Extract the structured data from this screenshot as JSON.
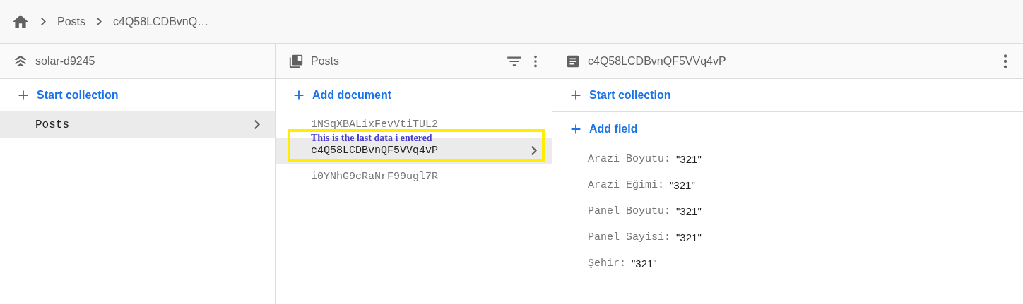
{
  "breadcrumb": [
    {
      "kind": "home"
    },
    {
      "kind": "text",
      "label": "Posts"
    },
    {
      "kind": "text",
      "label": "c4Q58LCDBvnQ…"
    }
  ],
  "columns": [
    {
      "kind": "project",
      "title": "solar-d9245",
      "actions": [
        "Start collection"
      ],
      "items": [
        {
          "label": "Posts",
          "selected": true
        }
      ]
    },
    {
      "kind": "collection",
      "title": "Posts",
      "actions": [
        "Add document"
      ],
      "items": [
        {
          "label": "1NSqXBALixFevVtiTUL2",
          "selected": false
        },
        {
          "label": "c4Q58LCDBvnQF5VVq4vP",
          "selected": true
        },
        {
          "label": "i0YNhG9cRaNrF99ugl7R",
          "selected": false
        }
      ],
      "annotation": {
        "text": "This is the last data i entered",
        "color": "#ffee00"
      }
    },
    {
      "kind": "document",
      "title": "c4Q58LCDBvnQF5VVq4vP",
      "actions": [
        "Start collection",
        "Add field"
      ],
      "fields": [
        {
          "key": "Arazi Boyutu:",
          "value": "\"321\""
        },
        {
          "key": "Arazi Eğimi:",
          "value": "\"321\""
        },
        {
          "key": "Panel Boyutu:",
          "value": "\"321\""
        },
        {
          "key": "Panel Sayisi:",
          "value": "\"321\""
        },
        {
          "key": "Şehir:",
          "value": "\"321\""
        }
      ]
    }
  ]
}
